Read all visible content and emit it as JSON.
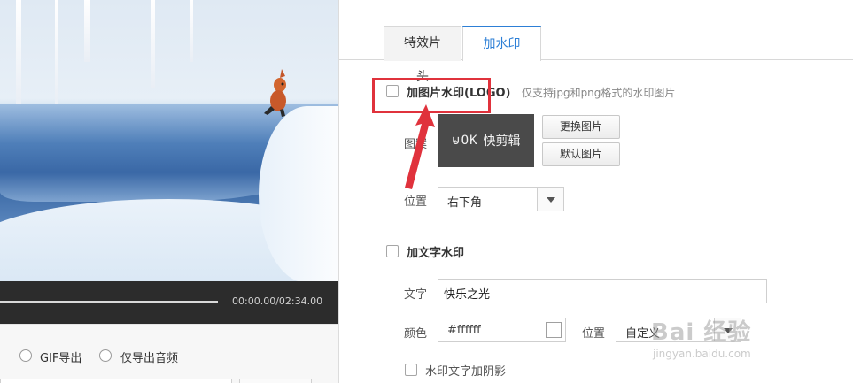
{
  "player": {
    "time_display": "00:00.00/02:34.00",
    "progress_fraction": 0.0
  },
  "export_options": {
    "gif_label": "GIF导出",
    "audio_only_label": "仅导出音频"
  },
  "tabs": [
    {
      "label": "特效片头",
      "active": false
    },
    {
      "label": "加水印",
      "active": true
    }
  ],
  "image_watermark": {
    "checkbox_label": "加图片水印(LOGO)",
    "checked": false,
    "hint": "仅支持jpg和png格式的水印图片",
    "pattern_label": "图案",
    "logo_mark": "⊌ОK",
    "logo_text": "快剪辑",
    "replace_button": "更换图片",
    "default_button": "默认图片",
    "position_label": "位置",
    "position_value": "右下角"
  },
  "text_watermark": {
    "checkbox_label": "加文字水印",
    "checked": false,
    "text_label": "文字",
    "text_value": "快乐之光",
    "color_label": "颜色",
    "color_value": "#ffffff",
    "position_label": "位置",
    "position_value": "自定义",
    "shadow_label": "水印文字加阴影",
    "shadow_checked": false
  },
  "annotation": {
    "color": "#e0323c"
  },
  "site_watermark": {
    "main": "Bai 经验",
    "sub": "jingyan.baidu.com"
  }
}
